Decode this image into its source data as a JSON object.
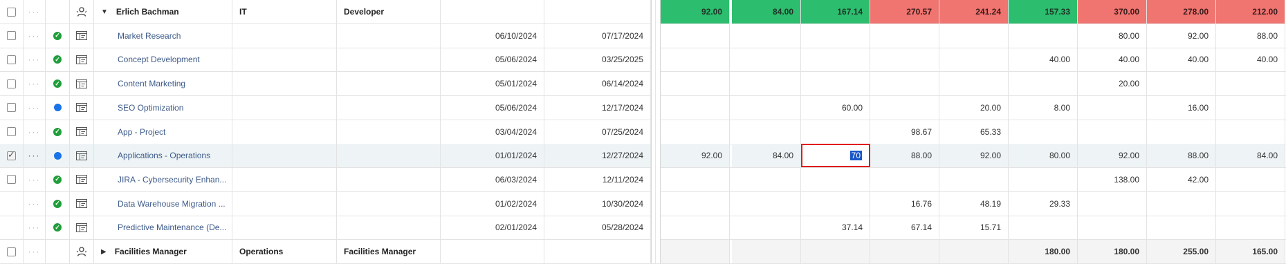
{
  "groups": [
    {
      "name": "Erlich Bachman",
      "department": "IT",
      "role": "Developer",
      "totals": [
        "92.00",
        "84.00",
        "167.14",
        "270.57",
        "241.24",
        "157.33",
        "370.00",
        "278.00",
        "212.00"
      ],
      "total_colors": [
        "green",
        "green",
        "green",
        "red",
        "red",
        "green",
        "red",
        "red",
        "red"
      ],
      "rows": [
        {
          "name": "Market Research",
          "start": "06/10/2024",
          "end": "07/17/2024",
          "status": "ok",
          "checkbox": true,
          "selected": false,
          "values": [
            "",
            "",
            "",
            "",
            "",
            "",
            "80.00",
            "92.00",
            "88.00"
          ]
        },
        {
          "name": "Concept Development",
          "start": "05/06/2024",
          "end": "03/25/2025",
          "status": "ok",
          "checkbox": true,
          "selected": false,
          "values": [
            "",
            "",
            "",
            "",
            "",
            "40.00",
            "40.00",
            "40.00",
            "40.00"
          ]
        },
        {
          "name": "Content Marketing",
          "start": "05/01/2024",
          "end": "06/14/2024",
          "status": "ok",
          "checkbox": true,
          "selected": false,
          "values": [
            "",
            "",
            "",
            "",
            "",
            "",
            "20.00",
            "",
            ""
          ]
        },
        {
          "name": "SEO Optimization",
          "start": "05/06/2024",
          "end": "12/17/2024",
          "status": "progress",
          "checkbox": true,
          "selected": false,
          "values": [
            "",
            "",
            "60.00",
            "",
            "20.00",
            "8.00",
            "",
            "16.00",
            ""
          ]
        },
        {
          "name": "App - Project",
          "start": "03/04/2024",
          "end": "07/25/2024",
          "status": "ok",
          "checkbox": true,
          "selected": false,
          "values": [
            "",
            "",
            "",
            "98.67",
            "65.33",
            "",
            "",
            "",
            ""
          ]
        },
        {
          "name": "Applications - Operations",
          "start": "01/01/2024",
          "end": "12/27/2024",
          "status": "progress",
          "checkbox": true,
          "selected": true,
          "editing_index": 2,
          "editing_value": "70",
          "values": [
            "92.00",
            "84.00",
            "70",
            "88.00",
            "92.00",
            "80.00",
            "92.00",
            "88.00",
            "84.00"
          ]
        },
        {
          "name": "JIRA - Cybersecurity Enhan...",
          "start": "06/03/2024",
          "end": "12/11/2024",
          "status": "ok",
          "checkbox": true,
          "selected": false,
          "values": [
            "",
            "",
            "",
            "",
            "",
            "",
            "138.00",
            "42.00",
            ""
          ]
        },
        {
          "name": "Data Warehouse Migration ...",
          "start": "01/02/2024",
          "end": "10/30/2024",
          "status": "ok",
          "checkbox": false,
          "selected": false,
          "values": [
            "",
            "",
            "",
            "16.76",
            "48.19",
            "29.33",
            "",
            "",
            ""
          ]
        },
        {
          "name": "Predictive Maintenance (De...",
          "start": "02/01/2024",
          "end": "05/28/2024",
          "status": "ok",
          "checkbox": false,
          "selected": false,
          "values": [
            "",
            "",
            "37.14",
            "67.14",
            "15.71",
            "",
            "",
            "",
            ""
          ]
        }
      ]
    },
    {
      "name": "Facilities Manager",
      "department": "Operations",
      "role": "Facilities Manager",
      "totals": [
        "",
        "",
        "",
        "",
        "",
        "180.00",
        "180.00",
        "255.00",
        "165.00"
      ],
      "total_colors": [
        "gray",
        "gray",
        "gray",
        "gray",
        "gray",
        "gray",
        "gray",
        "gray",
        "gray"
      ],
      "rows": []
    }
  ],
  "colors": {
    "green": "#2dbd6e",
    "red": "#f07470",
    "highlight": "#e01b1b",
    "selection": "#1a56c8"
  },
  "icons": {
    "status_ok": "check-circle-icon",
    "status_progress": "blue-dot-icon",
    "board": "board-icon",
    "resource": "person-icon",
    "expand": "caret-down-icon",
    "collapse": "caret-right-icon"
  }
}
